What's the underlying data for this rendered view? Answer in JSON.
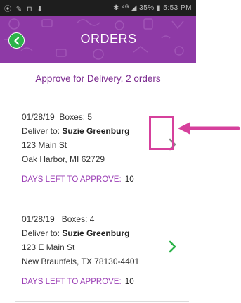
{
  "status_bar": {
    "left": "⦿ ✎ ⊓ ⬇",
    "right": "✱ ⁴ᴳ ◢ 35% ▮ 5:53 PM"
  },
  "header": {
    "title": "ORDERS",
    "back_icon": "chevron-left-icon"
  },
  "section": {
    "title": "Approve for Delivery, 2 orders"
  },
  "orders": [
    {
      "date": "01/28/19",
      "boxes_label": "Boxes:",
      "boxes": "5",
      "deliver_label": "Deliver to:",
      "name": "Suzie Greenburg",
      "address1": "123 Main St",
      "address2": "Oak Harbor, MI 62729",
      "days_label": "DAYS LEFT TO APPROVE:",
      "days": "10",
      "chevron_color": "#888888"
    },
    {
      "date": "01/28/19",
      "boxes_label": "Boxes:",
      "boxes": "4",
      "deliver_label": "Deliver to:",
      "name": "Suzie Greenburg",
      "address1": "123 E Main St",
      "address2": "New Braunfels, TX 78130-4401",
      "days_label": "DAYS LEFT TO APPROVE:",
      "days": "10",
      "chevron_color": "#2db34a"
    }
  ],
  "colors": {
    "header_bg": "#8e3aa6",
    "accent_purple": "#7b2a8f",
    "back_button": "#2db34a",
    "annotation": "#d6409c"
  }
}
